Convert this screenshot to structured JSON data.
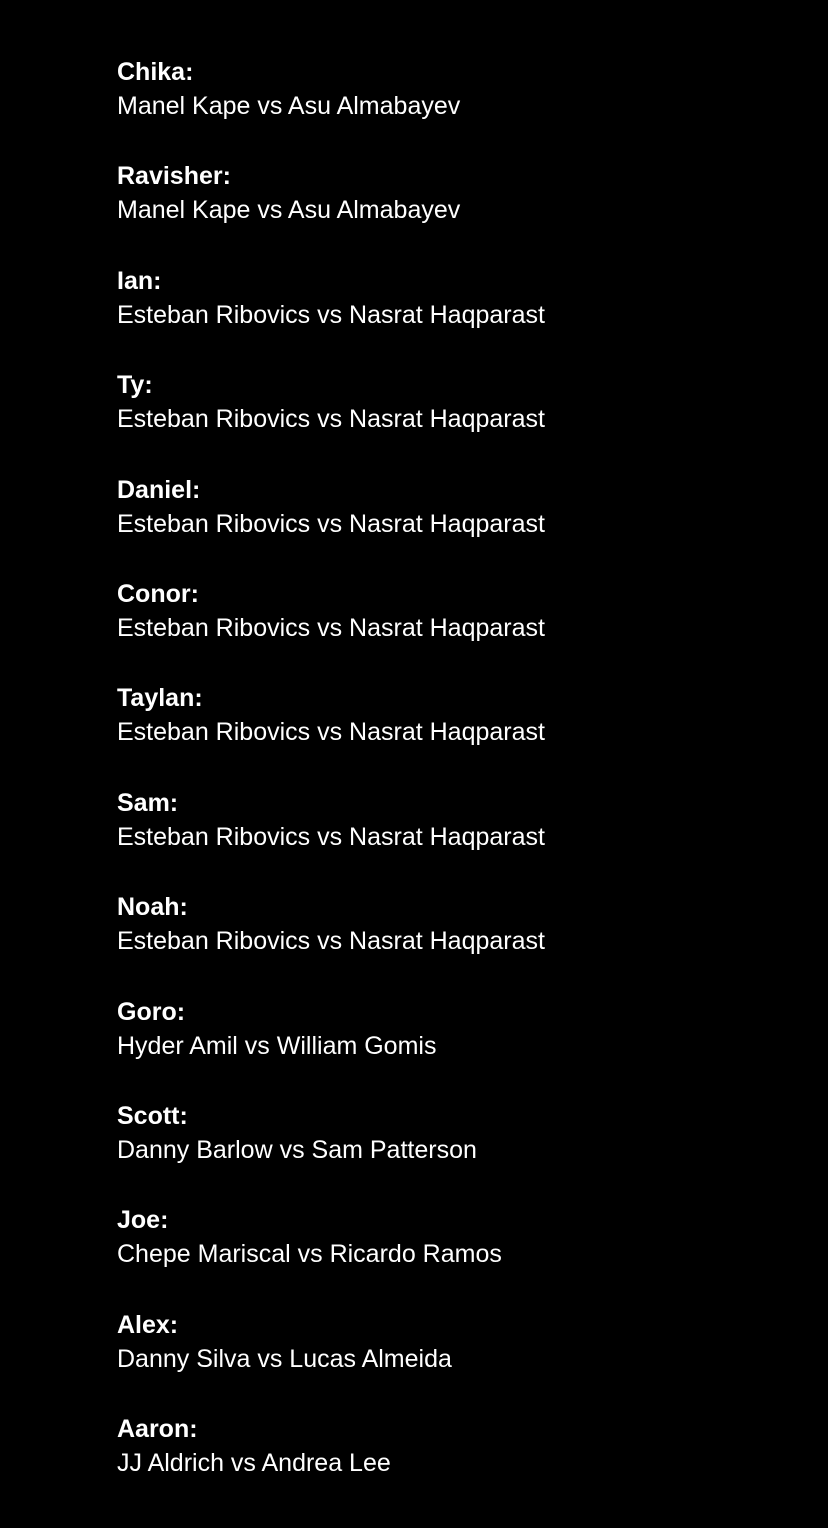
{
  "colors": {
    "background": "#000000",
    "text": "#ffffff"
  },
  "picks": [
    {
      "name": "Chika:",
      "matchup": "Manel Kape vs Asu Almabayev"
    },
    {
      "name": "Ravisher:",
      "matchup": "Manel Kape vs Asu Almabayev"
    },
    {
      "name": "Ian:",
      "matchup": "Esteban Ribovics vs Nasrat Haqparast"
    },
    {
      "name": "Ty:",
      "matchup": "Esteban Ribovics vs Nasrat Haqparast"
    },
    {
      "name": "Daniel:",
      "matchup": "Esteban Ribovics vs Nasrat Haqparast"
    },
    {
      "name": "Conor:",
      "matchup": "Esteban Ribovics vs Nasrat Haqparast"
    },
    {
      "name": "Taylan:",
      "matchup": "Esteban Ribovics vs Nasrat Haqparast"
    },
    {
      "name": "Sam:",
      "matchup": "Esteban Ribovics vs Nasrat Haqparast"
    },
    {
      "name": "Noah:",
      "matchup": "Esteban Ribovics vs Nasrat Haqparast"
    },
    {
      "name": "Goro:",
      "matchup": "Hyder Amil vs William Gomis"
    },
    {
      "name": "Scott:",
      "matchup": "Danny Barlow vs Sam Patterson"
    },
    {
      "name": "Joe:",
      "matchup": "Chepe Mariscal vs Ricardo Ramos"
    },
    {
      "name": "Alex:",
      "matchup": "Danny Silva vs Lucas Almeida"
    },
    {
      "name": "Aaron:",
      "matchup": "JJ Aldrich vs Andrea Lee"
    }
  ]
}
